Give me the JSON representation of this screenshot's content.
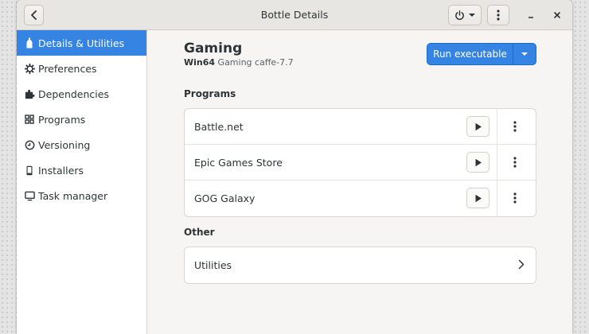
{
  "window": {
    "title": "Bottle Details"
  },
  "sidebar": {
    "items": [
      {
        "label": "Details & Utilities",
        "icon": "bottle-icon",
        "active": true
      },
      {
        "label": "Preferences",
        "icon": "gear-icon",
        "active": false
      },
      {
        "label": "Dependencies",
        "icon": "puzzle-icon",
        "active": false
      },
      {
        "label": "Programs",
        "icon": "grid-icon",
        "active": false
      },
      {
        "label": "Versioning",
        "icon": "clock-icon",
        "active": false
      },
      {
        "label": "Installers",
        "icon": "phone-icon",
        "active": false
      },
      {
        "label": "Task manager",
        "icon": "monitor-icon",
        "active": false
      }
    ]
  },
  "bottle": {
    "name": "Gaming",
    "arch": "Win64",
    "environment": "Gaming",
    "runner": "caffe-7.7"
  },
  "actions": {
    "run_label": "Run executable"
  },
  "programs": {
    "section_label": "Programs",
    "items": [
      {
        "name": "Battle.net"
      },
      {
        "name": "Epic Games Store"
      },
      {
        "name": "GOG Galaxy"
      }
    ]
  },
  "other": {
    "section_label": "Other",
    "items": [
      {
        "name": "Utilities"
      }
    ]
  },
  "colors": {
    "accent": "#3584e4",
    "sidebar_bg": "#ffffff",
    "window_bg": "#f6f5f4"
  }
}
